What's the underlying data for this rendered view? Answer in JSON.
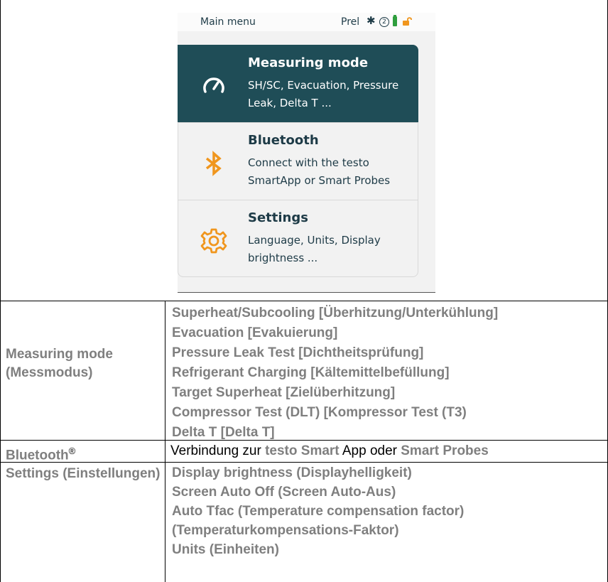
{
  "device": {
    "status_title": "Main menu",
    "status_prel": "Prel",
    "status_icons": [
      "bluetooth-icon",
      "circle-2-icon",
      "battery-icon",
      "lock-icon"
    ],
    "cards": [
      {
        "title": "Measuring mode",
        "desc": "SH/SC, Evacuation, Pressure Leak, Delta T ...",
        "icon": "gauge-icon"
      },
      {
        "title": "Bluetooth",
        "desc": "Connect with the testo SmartApp or Smart Probes",
        "icon": "bluetooth-icon"
      },
      {
        "title": "Settings",
        "desc": "Language, Units, Display brightness ...",
        "icon": "gear-icon"
      }
    ],
    "colors": {
      "active_card": "#1f4d57",
      "accent": "#f0961e",
      "text": "#1e3b47"
    }
  },
  "table": {
    "rows": [
      {
        "label": "Measuring mode (Messmodus)",
        "items": [
          "Superheat/Subcooling [Überhitzung/Unterkühlung]",
          "Evacuation [Evakuierung]",
          "Pressure Leak Test [Dichtheitsprüfung]",
          "Refrigerant Charging [Kältemittelbefüllung]",
          "Target Superheat [Zielüberhitzung]",
          "Compressor Test (DLT) [Kompressor Test (T3)",
          "Delta T [Delta T]"
        ]
      },
      {
        "label": "Bluetooth",
        "label_sup": "®",
        "desc_parts": [
          "Verbindung zur ",
          "testo Smart",
          " App oder ",
          "Smart Probes"
        ]
      },
      {
        "label": "Settings (Einstellungen)",
        "items": [
          "Display brightness (Displayhelligkeit)",
          "Screen Auto Off (Screen Auto-Aus)",
          "Auto Tfac (Temperature compensation factor) (Temperaturkompensations-Faktor)",
          "Units (Einheiten)"
        ]
      }
    ]
  }
}
